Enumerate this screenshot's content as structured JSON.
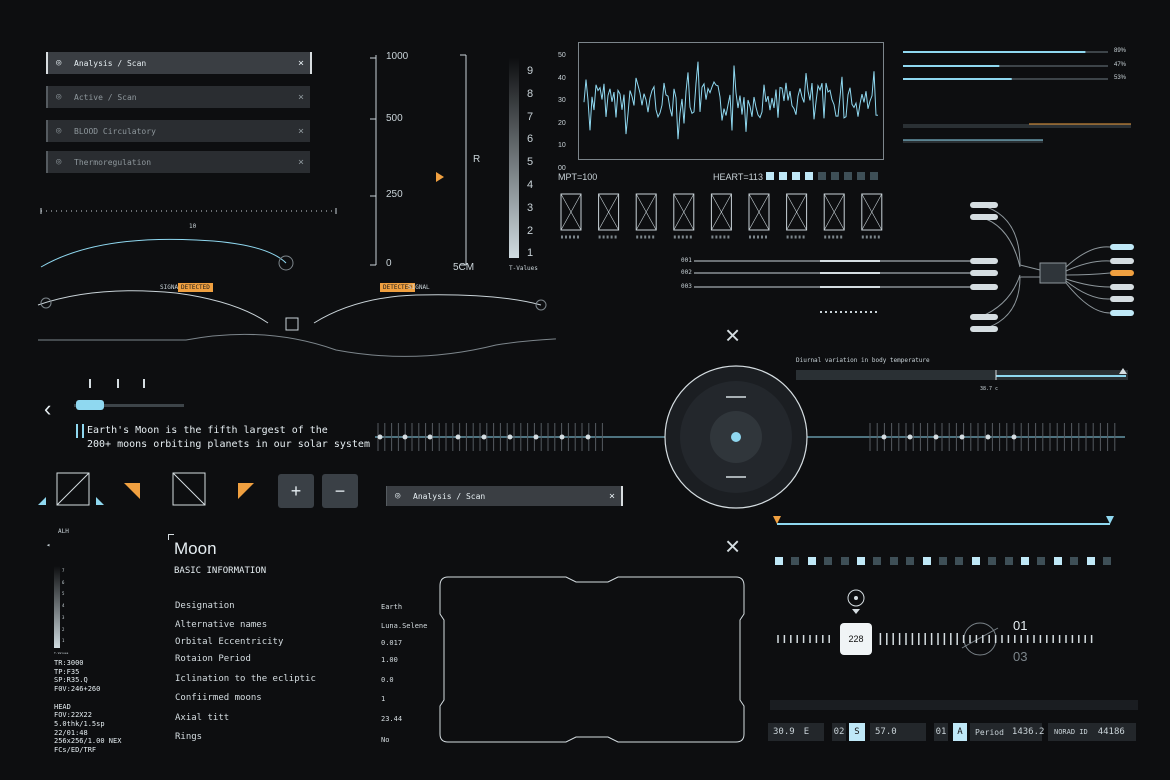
{
  "scan_menu": {
    "items": [
      {
        "label": "Analysis / Scan",
        "active": true
      },
      {
        "label": "Active / Scan"
      },
      {
        "label": "BLOOD Circulatory"
      },
      {
        "label": "Thermoregulation"
      }
    ],
    "close": "×",
    "icon": "◎"
  },
  "scale_gauge": {
    "ticks": [
      "1000",
      "500",
      "250",
      "0"
    ],
    "r_label": "R",
    "unit": "5CM"
  },
  "t_values": {
    "numbers": [
      "9",
      "8",
      "7",
      "6",
      "5",
      "4",
      "3",
      "2",
      "1"
    ],
    "label": "T-Values"
  },
  "waveform": {
    "y_ticks": [
      "50",
      "40",
      "30",
      "20",
      "10",
      "00"
    ],
    "mpt": "MPT=100",
    "heart": "HEART=113"
  },
  "bars": {
    "values": [
      "89%",
      "47%",
      "53%"
    ],
    "fractions": [
      0.89,
      0.47,
      0.53
    ]
  },
  "signal": {
    "left_word": "SIGNAL",
    "left_badge": "DETECTED",
    "right_badge": "DETECTED",
    "right_word": "SIGNAL",
    "center_tick": "10"
  },
  "node_labels": [
    "001",
    "002",
    "003"
  ],
  "temperature": {
    "title": "Diurnal variation in body temperature",
    "value": "38.7 c"
  },
  "moon_text": {
    "line1": "Earth's Moon is the fifth largest of the",
    "line2": "200+ moons orbiting planets in our solar system"
  },
  "zoom": {
    "plus": "+",
    "minus": "−"
  },
  "scan2": {
    "label": "Analysis / Scan",
    "close": "×",
    "icon": "◎"
  },
  "sidebar_left": {
    "title": "ALH",
    "scale": [
      "7",
      "6",
      "5",
      "4",
      "3",
      "2",
      "1"
    ],
    "scale_label": "T-Values",
    "stats": [
      "TR:3000",
      "TP:F35",
      "SP:R35.Q",
      "F0V:246+260",
      "",
      "HEAD",
      "FOV:22X22",
      "5.0thk/1.5sp",
      "22/01:48",
      "256x256/1.00 NEX",
      "FCs/ED/TRF"
    ]
  },
  "moon": {
    "title": "Moon",
    "subtitle": "BASIC INFORMATION",
    "rows": [
      {
        "label": "Designation",
        "value": "Earth"
      },
      {
        "label": "Alternative names",
        "value": "Luna.Selene"
      },
      {
        "label": "Orbital Eccentricity",
        "value": "0.017"
      },
      {
        "label": "Rotaion Period",
        "value": "1.00"
      },
      {
        "label": "Iclination to the ecliptic",
        "value": "0.0"
      },
      {
        "label": "Confiirmed moons",
        "value": "1"
      },
      {
        "label": "Axial titt",
        "value": "23.44"
      },
      {
        "label": "Rings",
        "value": "No"
      }
    ]
  },
  "dial": {
    "value": "228",
    "top": "01",
    "bottom": "03"
  },
  "footer": {
    "coord": "30.9",
    "dir": "E",
    "code1": "02",
    "s": "S",
    "val": "57.0",
    "code2": "01",
    "a": "A",
    "period_label": "Period",
    "period": "1436.2",
    "norad_label": "NORAD ID",
    "norad": "44186"
  },
  "colors": {
    "accent": "#8fd8f0",
    "orange": "#f0a040",
    "bg": "#0d0e10"
  }
}
